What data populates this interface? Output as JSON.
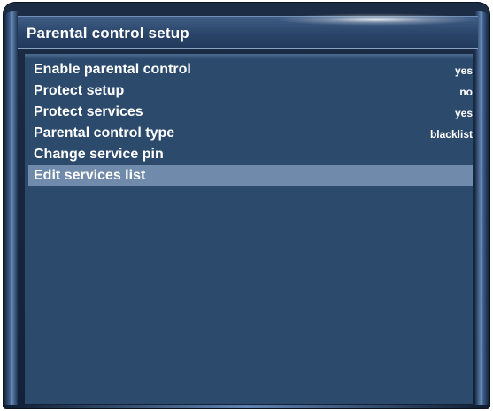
{
  "window": {
    "title": "Parental control setup"
  },
  "menu": {
    "items": [
      {
        "label": "Enable parental control",
        "value": "yes",
        "selected": false
      },
      {
        "label": "Protect setup",
        "value": "no",
        "selected": false
      },
      {
        "label": "Protect services",
        "value": "yes",
        "selected": false
      },
      {
        "label": "Parental control type",
        "value": "blacklist",
        "selected": false
      },
      {
        "label": "Change service pin",
        "value": "",
        "selected": false
      },
      {
        "label": "Edit services list",
        "value": "",
        "selected": true
      }
    ]
  },
  "colors": {
    "background": "#2c4a6c",
    "selection": "#6f8aaa",
    "text": "#ffffff"
  }
}
